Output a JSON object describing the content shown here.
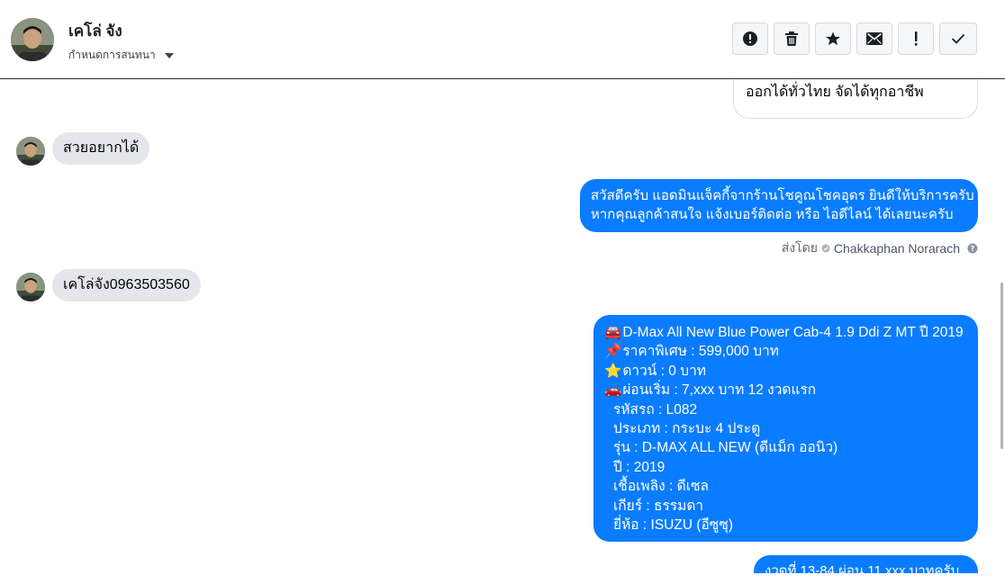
{
  "header": {
    "contact_name": "เคโล่ จัง",
    "conversation_settings": "กำหนดการสนทนา"
  },
  "toolbar": {
    "buttons": [
      "mark-spam",
      "delete",
      "star",
      "mark-unread",
      "important",
      "done"
    ]
  },
  "messages": {
    "prev_out_tail": "ออกได้ทั่วไทย จัดได้ทุกอาชีพ",
    "in_1": "สวยอยากได้",
    "out_1": [
      "สวัสดีครับ แอดมินแจ็คกี้จากร้านโชคูณโชคอุดร ยินดีให้บริการครับ",
      "หากคุณลูกค้าสนใจ แจ้งเบอร์ติดต่อ หรือ ไอดีไลน์ ได้เลยนะครับ"
    ],
    "sent_by_label": "ส่งโดย",
    "sent_by_name": "Chakkaphan Norarach",
    "in_2": "เคโล่จัง0963503560",
    "out_2": [
      {
        "emoji": "🚘",
        "text": "D-Max All New Blue Power Cab-4 1.9 Ddi Z MT ปี 2019"
      },
      {
        "emoji": "📌",
        "text": "ราคาพิเศษ : 599,000 บาท"
      },
      {
        "emoji": "⭐",
        "text": "ดาวน์ : 0 บาท"
      },
      {
        "emoji": "🚗",
        "text": "ผ่อนเริ่ม : 7,xxx บาท 12 งวดแรก"
      },
      {
        "emoji": "",
        "text": "รหัสรถ : L082"
      },
      {
        "emoji": "",
        "text": "ประเภท : กระบะ 4 ประตู"
      },
      {
        "emoji": "",
        "text": "รุ่น : D-MAX ALL NEW (ดีแม็ก ออนิว)"
      },
      {
        "emoji": "",
        "text": "ปี : 2019"
      },
      {
        "emoji": "",
        "text": "เชื้อเพลิง : ดีเซล"
      },
      {
        "emoji": "",
        "text": "เกียร์ : ธรรมดา"
      },
      {
        "emoji": "",
        "text": "ยี่ห้อ : ISUZU (อีซูซุ)"
      }
    ],
    "out_3_partial": "งวดที่ 13-84 ผ่อน 11,xxx บาทครับ"
  },
  "colors": {
    "outgoing_bubble": "#0a7cff",
    "incoming_bubble": "#e4e6eb"
  }
}
